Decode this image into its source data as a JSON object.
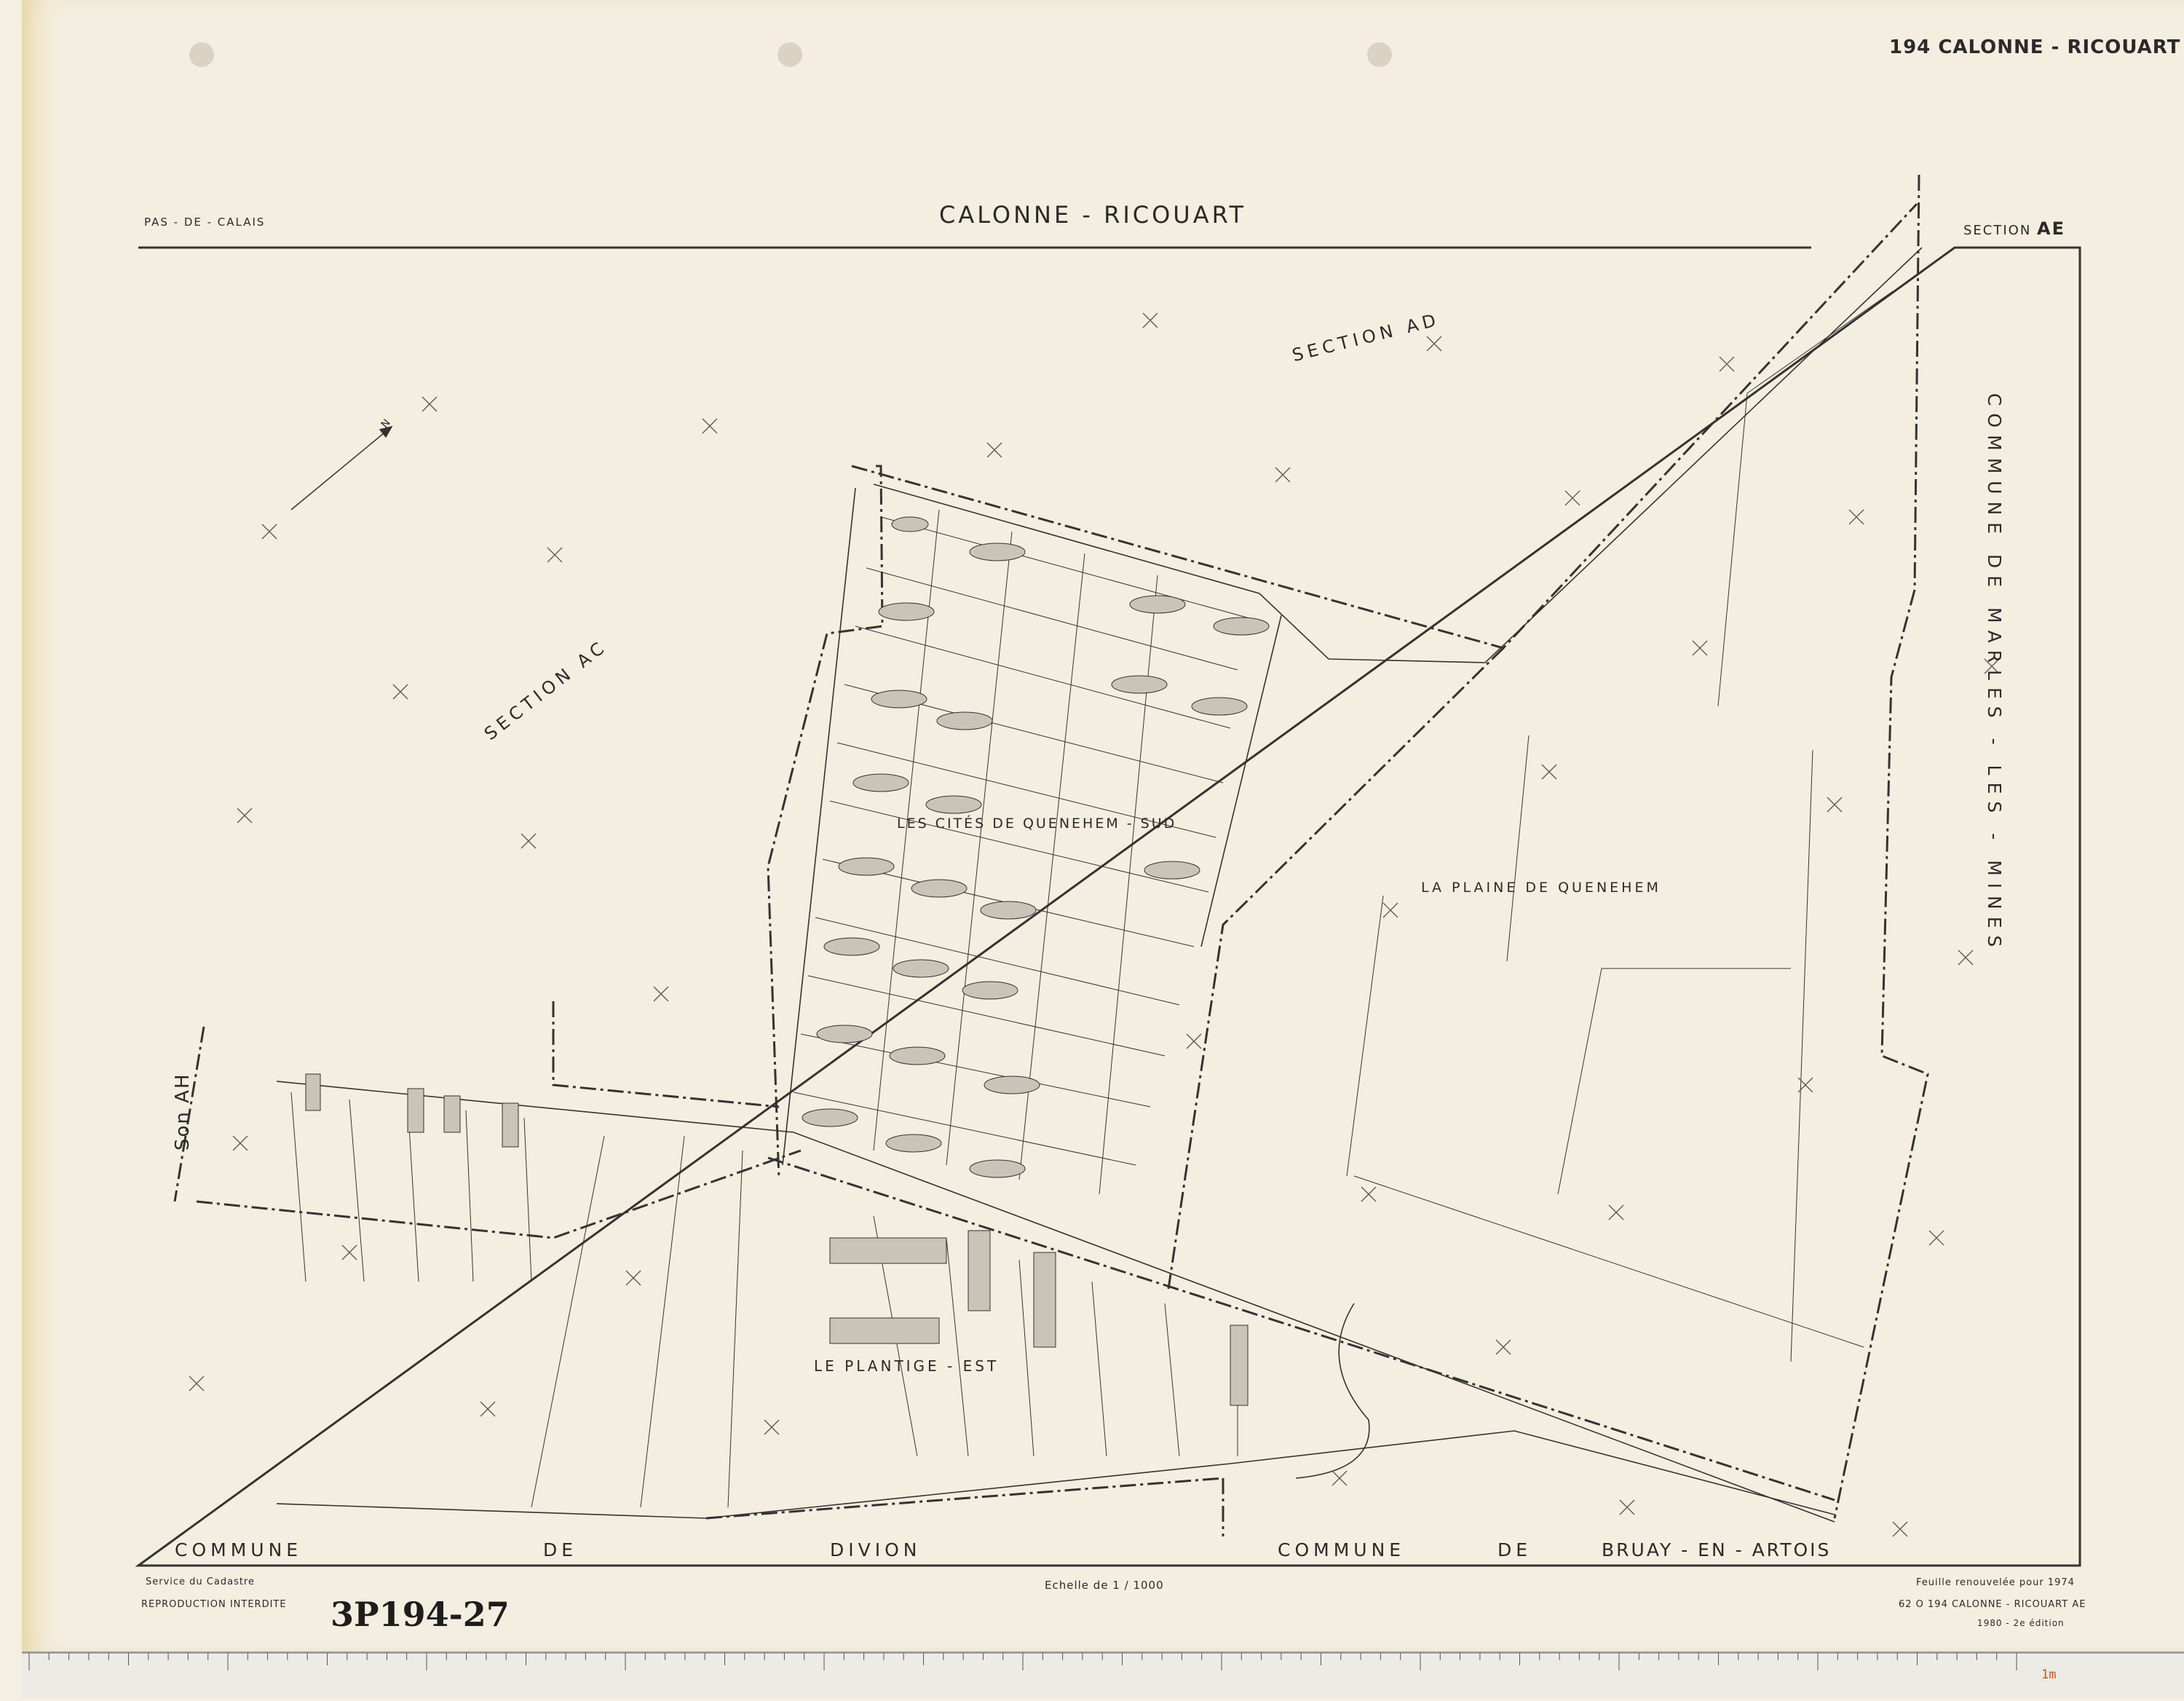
{
  "sheet": {
    "top_right_label": "194  CALONNE - RICOUART",
    "department": "PAS - DE - CALAIS",
    "commune_title": "CALONNE - RICOUART",
    "section_prefix": "SECTION",
    "section_code": "AE"
  },
  "map": {
    "sections": [
      "SECTION  AC",
      "SECTION  AD",
      "Son AH"
    ],
    "places": [
      "LES CITÉS DE QUENEHEM - SUD",
      "LA PLAINE DE QUENEHEM",
      "LE PLANTIGE - EST"
    ],
    "border_right": "COMMUNE   DE   MARLES - LES - MINES",
    "border_bottom": [
      "COMMUNE",
      "DE",
      "DIVION",
      "COMMUNE",
      "DE",
      "BRUAY - EN - ARTOIS"
    ],
    "north_arrow": "N"
  },
  "footer": {
    "service": "Service du Cadastre",
    "reproduction": "REPRODUCTION  INTERDITE",
    "handwritten_ref": "3P194-27",
    "scale": "Echelle de 1 / 1000",
    "renewed": "Feuille renouvelée pour 1974",
    "sheet_code": "62 O 194  CALONNE - RICOUART  AE",
    "edition": "1980  -  2e édition"
  },
  "ruler": {
    "end_label": "1m"
  },
  "colors": {
    "paper": "#f3eee0",
    "ink": "#2a2a2a",
    "ruler_marks": "#c2541d"
  }
}
